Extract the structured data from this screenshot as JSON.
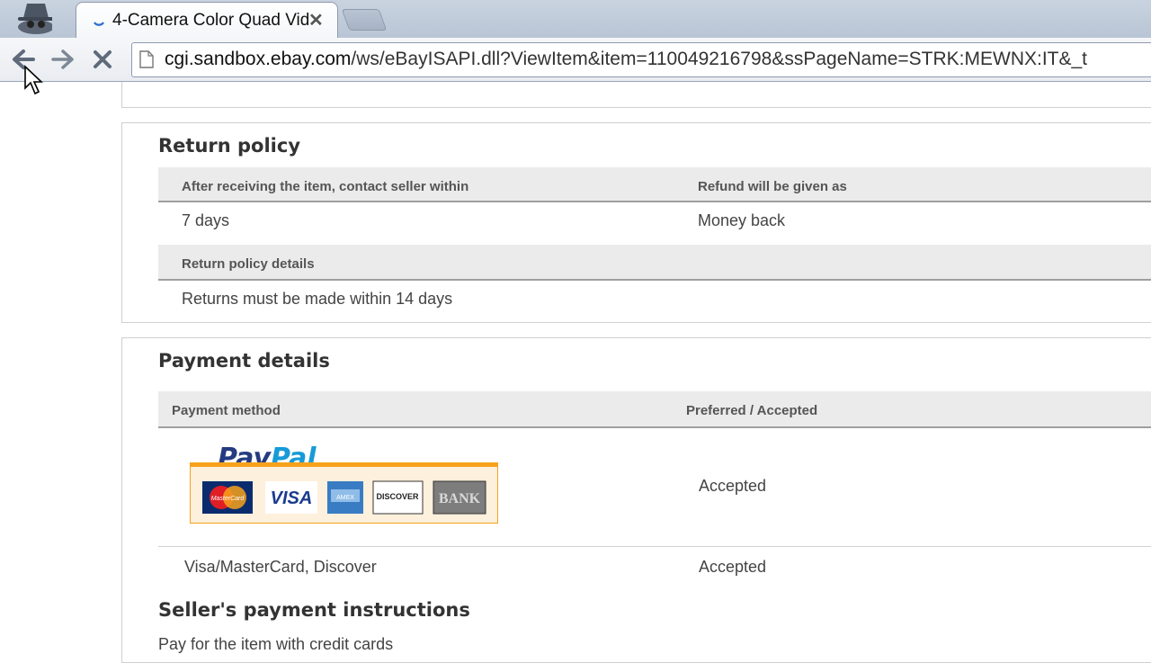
{
  "browser": {
    "tab_title": "4-Camera Color Quad Vid",
    "tab_close": "✕",
    "url_host": "cgi.sandbox.ebay.com",
    "url_path": "/ws/eBayISAPI.dll?ViewItem&item=110049216798&ssPageName=STRK:MEWNX:IT&_t"
  },
  "return_policy": {
    "title": "Return policy",
    "col1_header": "After receiving the item, contact seller within",
    "col2_header": "Refund will be given as",
    "col1_value": "7 days",
    "col2_value": "Money back",
    "details_header": "Return policy details",
    "details_value": "Returns must be made within 14 days"
  },
  "payment": {
    "title": "Payment details",
    "col1_header": "Payment method",
    "col2_header": "Preferred / Accepted",
    "rows": [
      {
        "method": "PayPal",
        "status": "Accepted"
      },
      {
        "method": "Visa/MasterCard, Discover",
        "status": "Accepted"
      }
    ],
    "paypal_logo": {
      "pay": "Pay",
      "pal": "Pal"
    },
    "cards": [
      "MasterCard",
      "VISA",
      "AMEX",
      "DISCOVER",
      "BANK"
    ],
    "instructions_title": "Seller's payment instructions",
    "instructions_text": "Pay for the item with credit cards"
  },
  "colors": {
    "paypal_navy": "#253b80",
    "paypal_blue": "#179bd7",
    "paypal_orange": "#f7a21b"
  }
}
